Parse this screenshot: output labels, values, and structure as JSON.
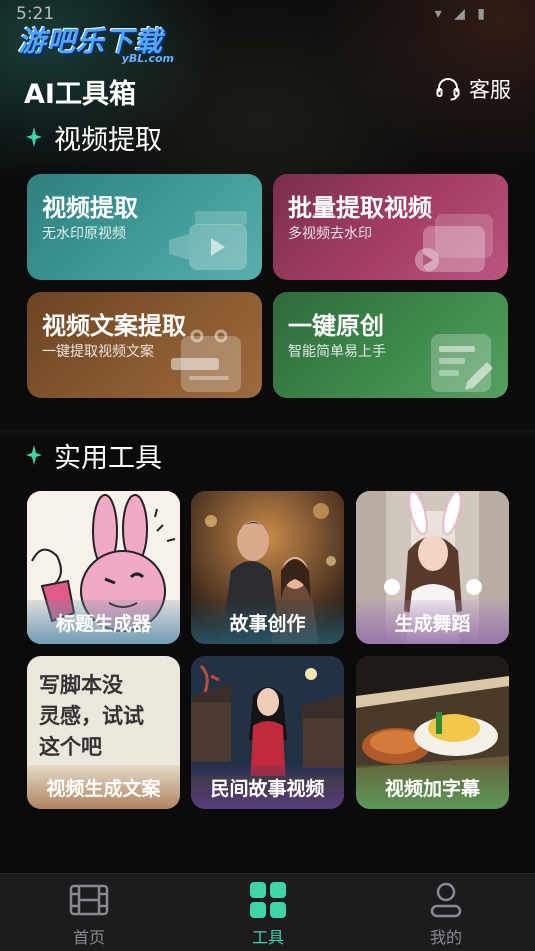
{
  "status_bar": {
    "time": "5:21",
    "icons": "▾ ◢ ▮"
  },
  "watermark": {
    "title": "游吧乐下载",
    "sub": "yBL.com"
  },
  "header": {
    "title": "AI工具箱",
    "service_label": "客服"
  },
  "sections": {
    "video_extract": {
      "title": "视频提取",
      "cards": [
        {
          "title": "视频提取",
          "subtitle": "无水印原视频"
        },
        {
          "title": "批量提取视频",
          "subtitle": "多视频去水印"
        },
        {
          "title": "视频文案提取",
          "subtitle": "一键提取视频文案"
        },
        {
          "title": "一键原创",
          "subtitle": "智能简单易上手"
        }
      ]
    },
    "tools": {
      "title": "实用工具",
      "cards": [
        {
          "label": "标题生成器"
        },
        {
          "label": "故事创作"
        },
        {
          "label": "生成舞蹈"
        },
        {
          "label": "视频生成文案",
          "art_text": [
            "写脚本没",
            "灵感，试试",
            "这个吧"
          ]
        },
        {
          "label": "民间故事视频"
        },
        {
          "label": "视频加字幕"
        }
      ]
    }
  },
  "tab_bar": {
    "tabs": [
      {
        "label": "首页",
        "icon": "film-icon",
        "active": false
      },
      {
        "label": "工具",
        "icon": "grid-icon",
        "active": true
      },
      {
        "label": "我的",
        "icon": "user-icon",
        "active": false
      }
    ],
    "active_color": "#3ed6a8",
    "inactive_color": "#8a8a8e"
  },
  "colors": {
    "accent": "#3ed6a8"
  }
}
